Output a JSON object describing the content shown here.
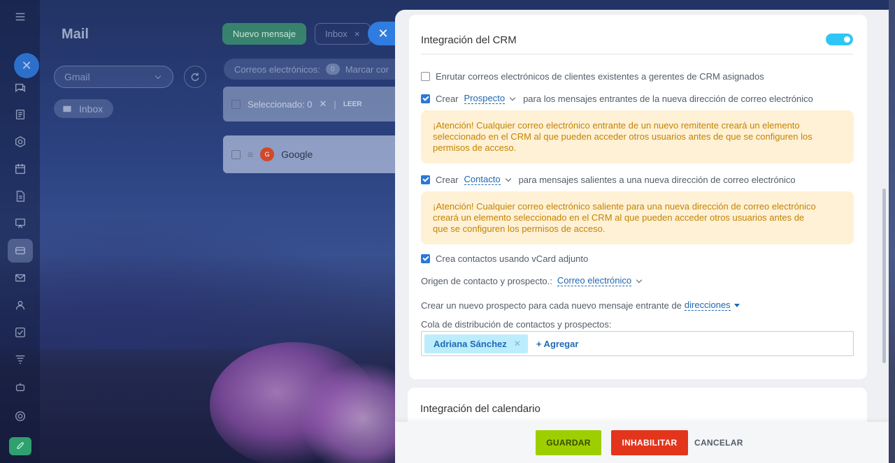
{
  "background_app": {
    "title": "Mail",
    "mailbox_select": "Gmail",
    "inbox_pill": "Inbox",
    "new_message_button": "Nuevo mensaje",
    "inbox_tab": "Inbox",
    "emails_label": "Correos electrónicos:",
    "emails_count": "0",
    "mark_label": "Marcar cor",
    "selected_label": "Seleccionado: 0",
    "read_label": "LEER",
    "mail_sender": "Google",
    "mail_sender_initial": "G"
  },
  "crm": {
    "title": "Integración del CRM",
    "toggle_on": true,
    "route_label": "Enrutar correos electrónicos de clientes existentes a gerentes de CRM asignados",
    "route_checked": false,
    "incoming_create": "Crear",
    "incoming_entity": "Prospecto",
    "incoming_text": "para los mensajes entrantes de la nueva dirección de correo electrónico",
    "incoming_checked": true,
    "warning1": [
      "¡Atención! Cualquier correo electrónico entrante de un nuevo remitente creará un elemento",
      "seleccionado en el CRM al que pueden acceder otros usuarios antes de que se configuren los",
      "permisos de acceso."
    ],
    "outgoing_create": "Crear",
    "outgoing_entity": "Contacto",
    "outgoing_text": "para mensajes salientes a una nueva dirección de correo electrónico",
    "outgoing_checked": true,
    "warning2": [
      "¡Atención! Cualquier correo electrónico saliente para una nueva dirección de correo electrónico",
      "creará un elemento seleccionado en el CRM al que pueden acceder otros usuarios antes de",
      "que se configuren los permisos de acceso."
    ],
    "vcard_label": "Crea contactos usando vCard adjunto",
    "vcard_checked": true,
    "source_label": "Origen de contacto y prospecto.:",
    "source_value": "Correo electrónico",
    "new_lead_label": "Crear un nuevo prospecto para cada nuevo mensaje entrante de",
    "new_lead_value": "direcciones",
    "queue_label": "Cola de distribución de contactos y prospectos:",
    "queue_user": "Adriana Sánchez",
    "add_label": "+ Agregar"
  },
  "calendar": {
    "title": "Integración del calendario"
  },
  "footer": {
    "save": "GUARDAR",
    "disable": "INHABILITAR",
    "cancel": "CANCELAR"
  },
  "colors": {
    "accent": "#2fc6f6",
    "save": "#9dcf00",
    "disable": "#e3351c",
    "warning_bg": "#fff1d6",
    "warning_text": "#c48300"
  }
}
